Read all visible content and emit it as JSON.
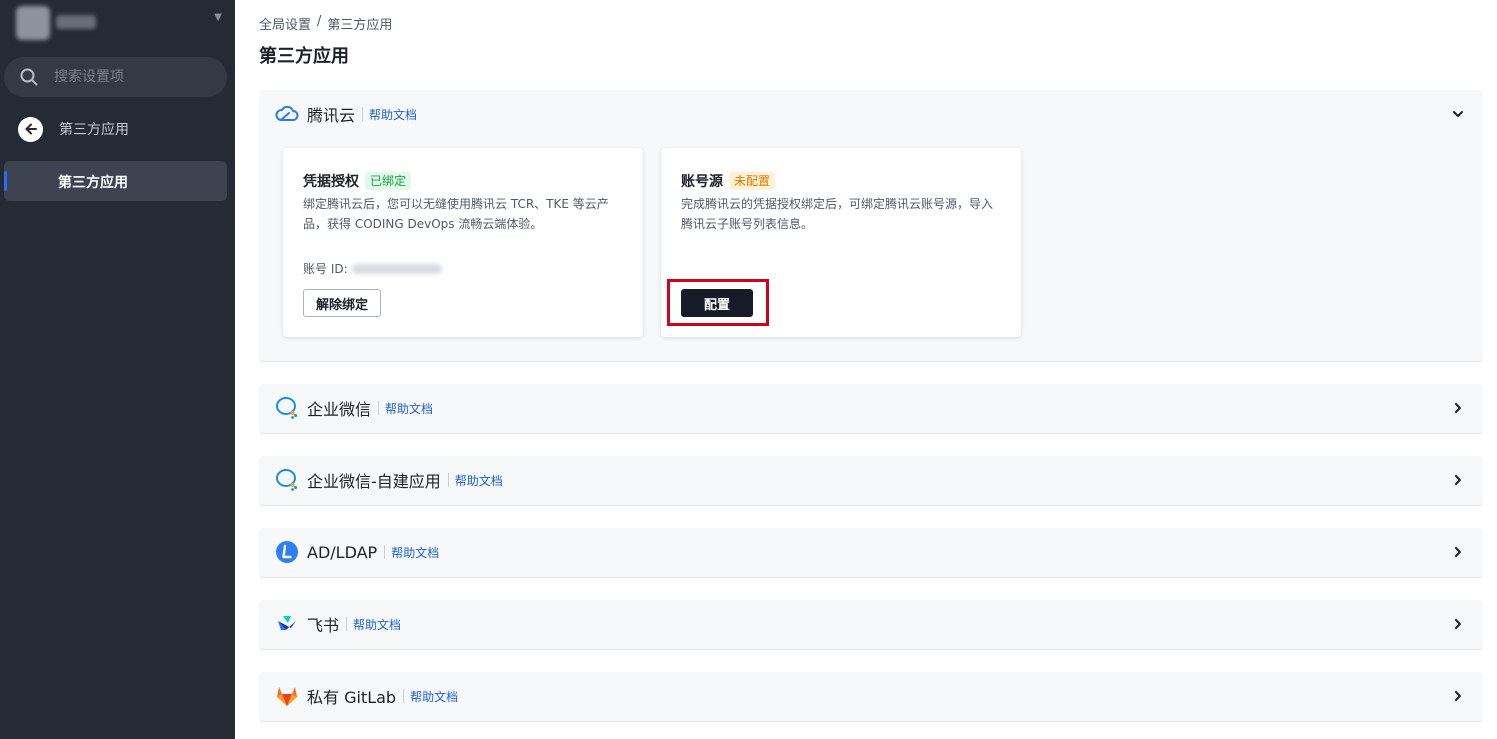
{
  "sidebar": {
    "search_placeholder": "搜索设置项",
    "back_label": "第三方应用",
    "nav_items": [
      {
        "label": "第三方应用"
      }
    ]
  },
  "breadcrumb": {
    "root": "全局设置",
    "separator": "/",
    "current": "第三方应用"
  },
  "page_title": "第三方应用",
  "help_label": "帮助文档",
  "sections": [
    {
      "name": "腾讯云",
      "icon": "cloud-icon",
      "expanded": true,
      "cards": [
        {
          "title": "凭据授权",
          "status": "已绑定",
          "description": "绑定腾讯云后，您可以无缝使用腾讯云 TCR、TKE 等云产品，获得 CODING DevOps 流畅云端体验。",
          "account_label": "账号 ID:",
          "button": "解除绑定"
        },
        {
          "title": "账号源",
          "status": "未配置",
          "description": "完成腾讯云的凭据授权绑定后，可绑定腾讯云账号源，导入腾讯云子账号列表信息。",
          "button": "配置"
        }
      ]
    },
    {
      "name": "企业微信",
      "icon": "wecom-icon"
    },
    {
      "name": "企业微信-自建应用",
      "icon": "wecom-icon"
    },
    {
      "name": "AD/LDAP",
      "icon": "ldap-icon"
    },
    {
      "name": "飞书",
      "icon": "feishu-icon"
    },
    {
      "name": "私有 GitLab",
      "icon": "gitlab-icon"
    }
  ],
  "colors": {
    "sidebar_bg": "#262a35",
    "link": "#1f5fd8",
    "bound_tag": "#15a34a",
    "unconfigured_tag": "#d97a00",
    "highlight": "#d0021b"
  }
}
